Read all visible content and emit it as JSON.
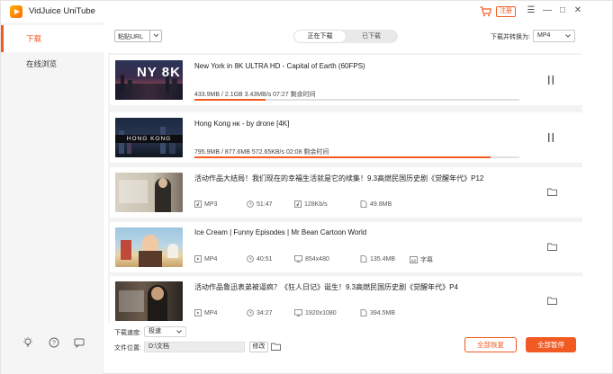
{
  "window": {
    "title": "VidJuice UniTube",
    "register_label": "注册"
  },
  "sidebar": {
    "items": [
      {
        "label": "下载",
        "active": true
      },
      {
        "label": "在线浏览",
        "active": false
      }
    ]
  },
  "toolbar": {
    "paste_url_label": "粘贴URL",
    "tabs": [
      {
        "label": "正在下载",
        "active": true
      },
      {
        "label": "已下载",
        "active": false
      }
    ],
    "convert_label": "下载并转换为:",
    "convert_value": "MP4"
  },
  "downloads": [
    {
      "title": "New York in 8K ULTRA HD - Capital of Earth (60FPS)",
      "progress_text": "433.9MB / 2.1GB  3.43MB/s  07:27 剩余时间",
      "progress": 0.22,
      "thumb_text": "NY 8K"
    },
    {
      "title": "Hong Kong ʜᴋ - by drone [4K]",
      "progress_text": "795.9MB / 877.6MB  572.65KB/s  02:08 剩余时间",
      "progress": 0.91,
      "thumb_text": "HONG KONG"
    }
  ],
  "completed": [
    {
      "title": "活动作品大结局！我们现在的幸福生活就是它的续集！9.3高燃民国历史剧《觉醒年代》P12",
      "format": "MP3",
      "duration": "51:47",
      "quality": "128Kb/s",
      "size": "49.8MB",
      "subtitle": ""
    },
    {
      "title": "Ice Cream | Funny Episodes | Mr Bean Cartoon World",
      "format": "MP4",
      "duration": "40:51",
      "quality": "854x480",
      "size": "135.4MB",
      "subtitle": "字幕"
    },
    {
      "title": "活动作品鲁迅表弟被逼疯？《狂人日记》诞生！9.3高燃民国历史剧《觉醒年代》P4",
      "format": "MP4",
      "duration": "34:27",
      "quality": "1920x1080",
      "size": "394.5MB",
      "subtitle": ""
    }
  ],
  "bottom": {
    "speed_label": "下载速度:",
    "speed_value": "极速",
    "location_label": "文件位置:",
    "location_value": "D:\\文档",
    "change_label": "修改",
    "resume_all_label": "全部恢复",
    "pause_all_label": "全部暂停"
  },
  "colors": {
    "accent": "#f15a22",
    "progress_track": "#e0e0e0",
    "sidebar_bg": "#f5f5f5",
    "list_bg": "#f3f3f3"
  },
  "icons": [
    "app-logo-icon",
    "cart-icon",
    "menu-icon",
    "minimize-icon",
    "maximize-icon",
    "close-icon",
    "bulb-icon",
    "help-icon",
    "feedback-icon",
    "pause-icon",
    "folder-icon",
    "music-icon",
    "video-icon",
    "clock-icon",
    "monitor-icon",
    "file-icon",
    "subtitle-icon"
  ]
}
